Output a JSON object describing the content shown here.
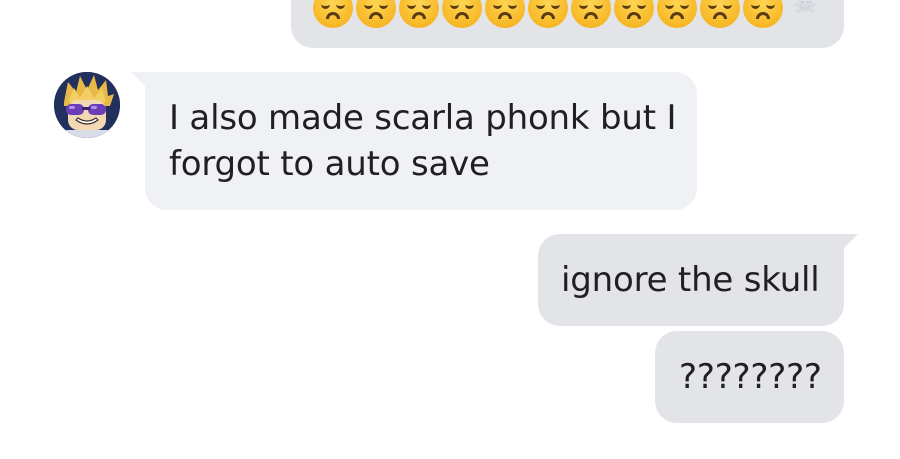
{
  "conversation": {
    "top_emoji_message": {
      "emojis": [
        "disappointed-face",
        "disappointed-face",
        "disappointed-face",
        "disappointed-face",
        "disappointed-face",
        "disappointed-face",
        "disappointed-face",
        "disappointed-face",
        "disappointed-face",
        "disappointed-face",
        "disappointed-face",
        "skull"
      ]
    },
    "incoming_message": {
      "lines": [
        "I also made scarla phonk but I",
        "forgot to auto save"
      ]
    },
    "outgoing_messages": [
      {
        "text": "ignore the skull"
      },
      {
        "text": "????????"
      }
    ]
  },
  "colors": {
    "incoming_bubble": "#f0f1f4",
    "outgoing_bubble": "#e3e4e8",
    "text": "#1f1f24",
    "emoji_yellow": "#f7b725"
  }
}
